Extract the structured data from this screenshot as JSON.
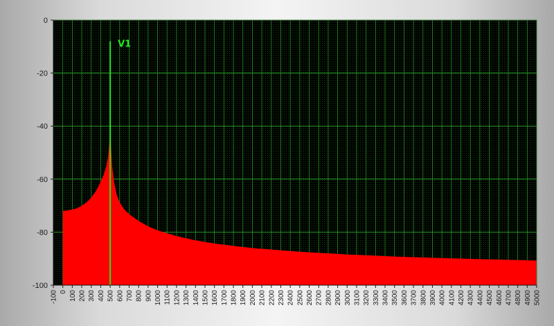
{
  "chart_data": {
    "type": "area",
    "xlim": [
      -100,
      5000
    ],
    "ylim": [
      -100,
      0
    ],
    "x_ticks": [
      -100,
      0,
      100,
      200,
      300,
      400,
      500,
      600,
      700,
      800,
      900,
      1000,
      1100,
      1200,
      1300,
      1400,
      1500,
      1600,
      1700,
      1800,
      1900,
      2000,
      2100,
      2200,
      2300,
      2400,
      2500,
      2600,
      2700,
      2800,
      2900,
      3000,
      3100,
      3200,
      3300,
      3400,
      3500,
      3600,
      3700,
      3800,
      3900,
      4000,
      4100,
      4200,
      4300,
      4400,
      4500,
      4600,
      4700,
      4800,
      4900,
      5000
    ],
    "y_ticks": [
      0,
      -20,
      -40,
      -60,
      -80,
      -100
    ],
    "grid": true,
    "background_color": "#000000",
    "grid_color": "#2a9a2a",
    "x_minor_grid_step": 20,
    "series": [
      {
        "color": "#ff0000",
        "x": [
          0,
          50,
          100,
          150,
          200,
          250,
          300,
          350,
          400,
          430,
          460,
          480,
          490,
          495,
          500,
          505,
          510,
          520,
          540,
          570,
          600,
          650,
          700,
          800,
          900,
          1000,
          1200,
          1400,
          1600,
          1800,
          2000,
          2500,
          3000,
          3500,
          4000,
          4500,
          5000
        ],
        "y": [
          -72,
          -71.8,
          -71.5,
          -71,
          -70,
          -68.8,
          -67,
          -64.5,
          -61,
          -58.5,
          -55,
          -51,
          -47,
          -42,
          -37,
          -42,
          -48,
          -55,
          -61,
          -66,
          -68.8,
          -71.5,
          -73.2,
          -75.8,
          -77.8,
          -79.3,
          -81.5,
          -83.1,
          -84.3,
          -85.2,
          -86,
          -87.4,
          -88.4,
          -89.2,
          -89.8,
          -90.3,
          -90.7
        ]
      }
    ],
    "markers": [
      {
        "label": "V1",
        "x": 500,
        "y_top": -8,
        "color": "#22e822"
      }
    ]
  }
}
